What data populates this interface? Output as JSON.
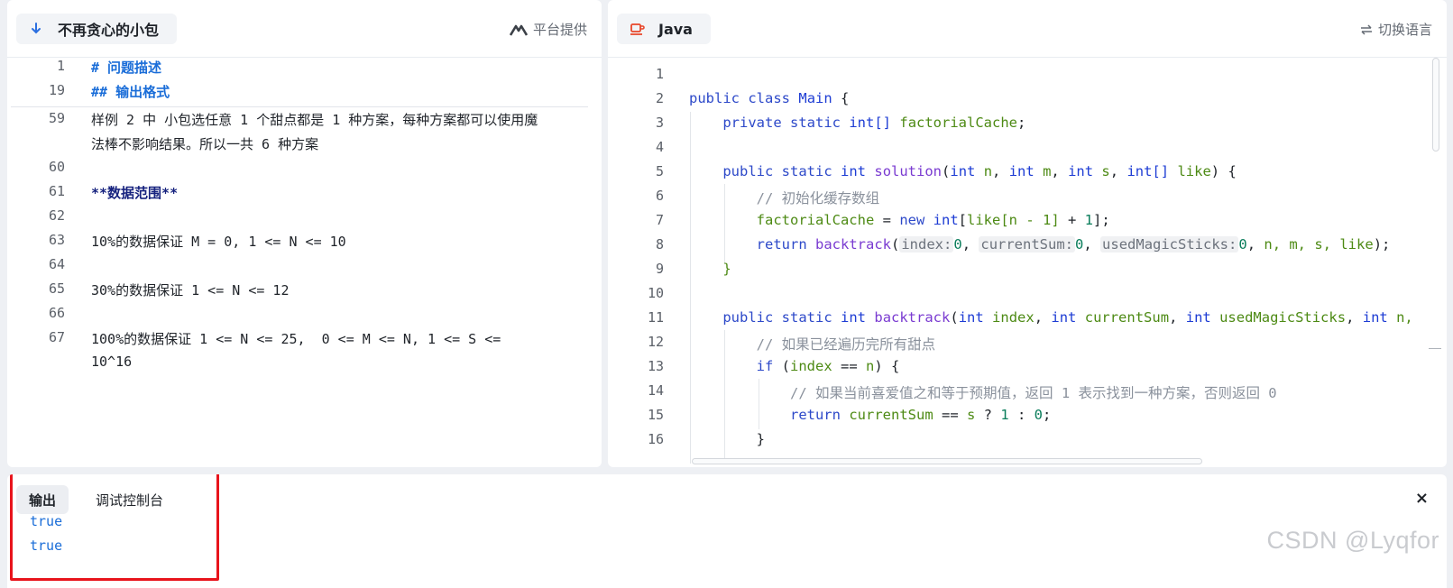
{
  "left_panel": {
    "title": "不再贪心的小包",
    "provider": "平台提供",
    "lines": [
      {
        "num": "1",
        "text": "# 问题描述"
      },
      {
        "num": "19",
        "text": "## 输出格式"
      },
      {
        "num": "59",
        "text": "样例 2 中 小包选任意 1 个甜点都是 1 种方案，每种方案都可以使用魔"
      },
      {
        "num": "",
        "text": "法棒不影响结果。所以一共 6 种方案"
      },
      {
        "num": "60",
        "text": ""
      },
      {
        "num": "61",
        "text": "**数据范围**"
      },
      {
        "num": "62",
        "text": ""
      },
      {
        "num": "63",
        "text": "10%的数据保证 M = 0, 1 <= N <= 10"
      },
      {
        "num": "64",
        "text": ""
      },
      {
        "num": "65",
        "text": "30%的数据保证 1 <= N <= 12"
      },
      {
        "num": "66",
        "text": ""
      },
      {
        "num": "67",
        "text": "100%的数据保证 1 <= N <= 25,  0 <= M <= N, 1 <= S <="
      },
      {
        "num": "",
        "text": "10^16"
      }
    ]
  },
  "right_panel": {
    "language": "Java",
    "switch_label": "切换语言",
    "line_numbers": [
      "1",
      "2",
      "3",
      "4",
      "5",
      "6",
      "7",
      "8",
      "9",
      "10",
      "11",
      "12",
      "13",
      "14",
      "15",
      "16"
    ],
    "code": {
      "l2": {
        "kw1": "public",
        "kw2": "class",
        "name": "Main",
        "brace": "{"
      },
      "l3": {
        "kw1": "private",
        "kw2": "static",
        "type": "int[]",
        "name": "factorialCache",
        "end": ";"
      },
      "l5": {
        "kw1": "public",
        "kw2": "static",
        "type": "int",
        "fn": "solution",
        "p1t": "int",
        "p1": "n",
        "p2t": "int",
        "p2": "m",
        "p3t": "int",
        "p3": "s",
        "p4t": "int[]",
        "p4": "like",
        "end": ") {"
      },
      "l6": {
        "comment": "// 初始化缓存数组"
      },
      "l7": {
        "name": "factorialCache",
        "op": " = ",
        "kw": "new",
        "type": "int",
        "idx_open": "[",
        "arr": "like",
        "arr_idx": "[n - 1]",
        "plus": " + ",
        "one": "1",
        "end": "];"
      },
      "l8": {
        "kw": "return",
        "fn": "backtrack",
        "h1": "index:",
        "v1": "0",
        "h2": "currentSum:",
        "v2": "0",
        "h3": "usedMagicSticks:",
        "v3": "0",
        "rest": "n, m, s, like",
        "end": ");"
      },
      "l9": {
        "brace": "}"
      },
      "l11": {
        "kw1": "public",
        "kw2": "static",
        "type": "int",
        "fn": "backtrack",
        "p1t": "int",
        "p1": "index",
        "p2t": "int",
        "p2": "currentSum",
        "p3t": "int",
        "p3": "usedMagicSticks",
        "p4t": "int",
        "p4": "n,"
      },
      "l12": {
        "comment": "// 如果已经遍历完所有甜点"
      },
      "l13": {
        "kw": "if",
        "cond_open": " (",
        "a": "index",
        "op": " == ",
        "b": "n",
        "end": ") {"
      },
      "l14": {
        "comment": "// 如果当前喜爱值之和等于预期值，返回 1 表示找到一种方案，否则返回 0"
      },
      "l15": {
        "kw": "return",
        "a": "currentSum",
        "op": " == ",
        "b": "s",
        "q": " ? ",
        "one": "1",
        "colon": " : ",
        "zero": "0",
        "end": ";"
      },
      "l16": {
        "brace": "}"
      }
    }
  },
  "bottom_panel": {
    "tab_output": "输出",
    "tab_console": "调试控制台",
    "output": [
      "true",
      "true"
    ],
    "close": "×"
  },
  "watermark": "CSDN @Lyqfor",
  "colors": {
    "keyword": "#1d3cd4",
    "function": "#7a3bd1",
    "identifier": "#4d8a14",
    "number": "#0a7d5b",
    "comment": "#8a919c",
    "heading": "#1a6dd8",
    "highlight_box": "#e8141c"
  }
}
